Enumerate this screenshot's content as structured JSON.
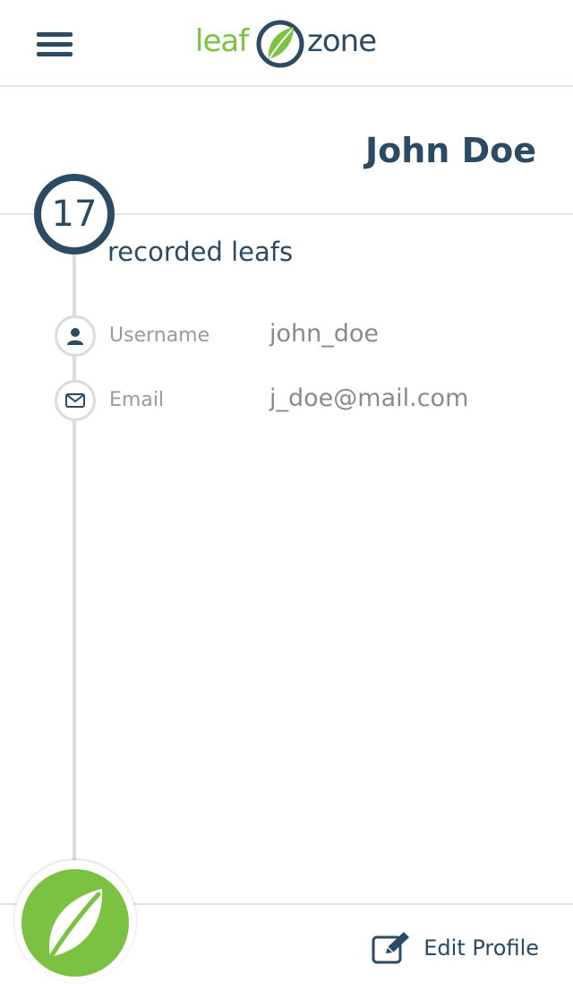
{
  "header": {
    "logo": {
      "part1": "leaf",
      "part2": "zone"
    },
    "menu_icon": "hamburger-menu-icon"
  },
  "profile": {
    "name": "John Doe",
    "leaf_count": "17",
    "leaf_count_label": "recorded leafs",
    "fields": {
      "username": {
        "label": "Username",
        "value": "john_doe",
        "icon": "user-icon"
      },
      "email": {
        "label": "Email",
        "value": "j_doe@mail.com",
        "icon": "envelope-icon"
      }
    }
  },
  "footer": {
    "fab_icon": "leaf-icon",
    "edit_profile_label": "Edit Profile",
    "edit_icon": "edit-icon"
  },
  "colors": {
    "primary": "#2b4a63",
    "accent": "#7cc242",
    "muted": "#9a9a9a",
    "divider": "#dcdcdc"
  }
}
